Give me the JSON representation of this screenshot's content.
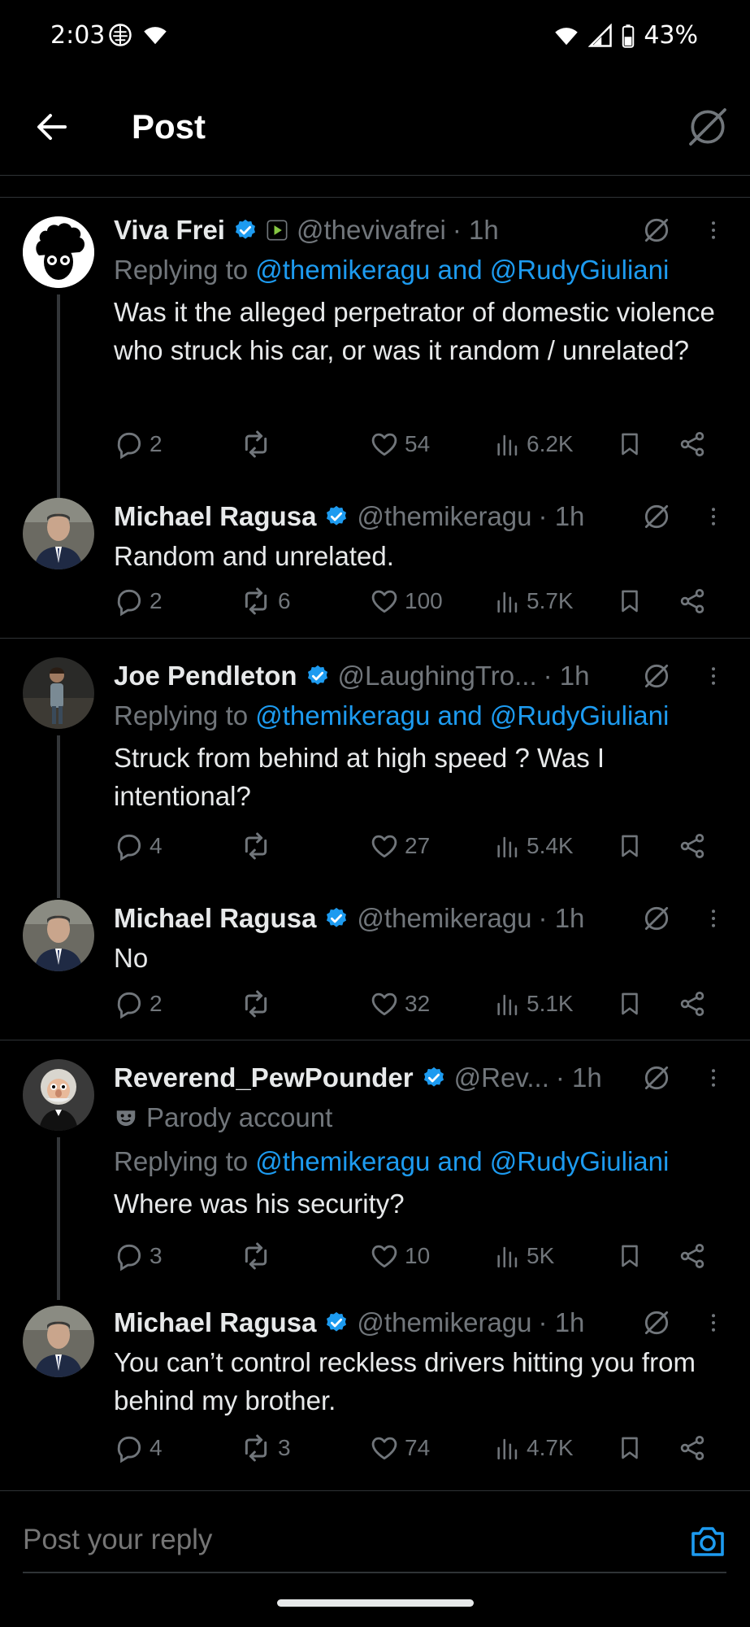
{
  "status_bar": {
    "time": "2:03",
    "battery": "43%"
  },
  "header": {
    "title": "Post"
  },
  "tweets": [
    {
      "name": "Viva Frei",
      "handle": "@thevivafrei",
      "time": "· 1h",
      "replying_prefix": "Replying to ",
      "replying_to": "@themikeragu and @RudyGiuliani",
      "text": "Was it the alleged perpetrator of domestic violence who struck his car, or was it random / unrelated?",
      "replies": "2",
      "reposts": "",
      "likes": "54",
      "views": "6.2K"
    },
    {
      "name": "Michael Ragusa",
      "handle": "@themikeragu",
      "time": "· 1h",
      "text": "Random and unrelated.",
      "replies": "2",
      "reposts": "6",
      "likes": "100",
      "views": "5.7K"
    },
    {
      "name": "Joe Pendleton",
      "handle": "@LaughingTro...",
      "time": "· 1h",
      "replying_prefix": "Replying to ",
      "replying_to": "@themikeragu and @RudyGiuliani",
      "text": "Struck from behind at high speed ? Was I intentional?",
      "replies": "4",
      "reposts": "",
      "likes": "27",
      "views": "5.4K"
    },
    {
      "name": "Michael Ragusa",
      "handle": "@themikeragu",
      "time": "· 1h",
      "text": "No",
      "replies": "2",
      "reposts": "",
      "likes": "32",
      "views": "5.1K"
    },
    {
      "name": "Reverend_PewPounder",
      "handle": "@Rev...",
      "time": "· 1h",
      "parody": "Parody account",
      "replying_prefix": "Replying to ",
      "replying_to": "@themikeragu and @RudyGiuliani",
      "text": "Where was his security?",
      "replies": "3",
      "reposts": "",
      "likes": "10",
      "views": "5K"
    },
    {
      "name": "Michael Ragusa",
      "handle": "@themikeragu",
      "time": "· 1h",
      "text": "You can’t control reckless drivers hitting you from behind my brother.",
      "replies": "4",
      "reposts": "3",
      "likes": "74",
      "views": "4.7K"
    }
  ],
  "reply_bar": {
    "placeholder": "Post your reply"
  },
  "colors": {
    "background": "#000000",
    "accent": "#1d9bf0",
    "muted": "#71767b",
    "text": "#e7e9ea",
    "border": "#2f3336"
  }
}
